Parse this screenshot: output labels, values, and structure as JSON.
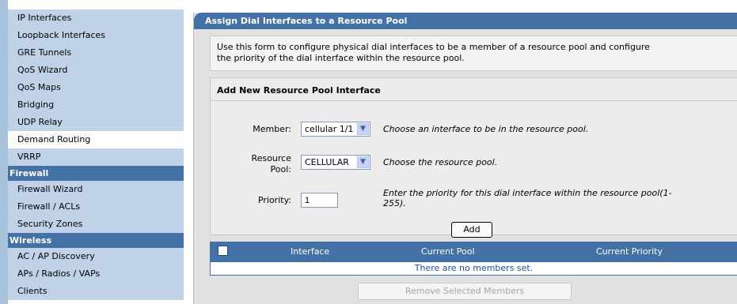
{
  "sidebar": {
    "items": [
      {
        "label": "IP Interfaces",
        "type": "item"
      },
      {
        "label": "Loopback Interfaces",
        "type": "item"
      },
      {
        "label": "GRE Tunnels",
        "type": "item"
      },
      {
        "label": "QoS Wizard",
        "type": "item"
      },
      {
        "label": "QoS Maps",
        "type": "item"
      },
      {
        "label": "Bridging",
        "type": "item"
      },
      {
        "label": "UDP Relay",
        "type": "item"
      },
      {
        "label": "Demand Routing",
        "type": "item",
        "active": true
      },
      {
        "label": "VRRP",
        "type": "item"
      },
      {
        "label": "Firewall",
        "type": "heading"
      },
      {
        "label": "Firewall Wizard",
        "type": "item"
      },
      {
        "label": "Firewall / ACLs",
        "type": "item"
      },
      {
        "label": "Security Zones",
        "type": "item"
      },
      {
        "label": "Wireless",
        "type": "heading"
      },
      {
        "label": "AC / AP Discovery",
        "type": "item"
      },
      {
        "label": "APs / Radios / VAPs",
        "type": "item"
      },
      {
        "label": "Clients",
        "type": "item"
      }
    ]
  },
  "panel": {
    "title": "Assign Dial Interfaces to a Resource Pool",
    "description_line1": "Use this form to configure physical dial interfaces to be a member of a resource pool and configure",
    "description_line2": "the priority of the dial interface within the resource pool."
  },
  "form": {
    "title": "Add New Resource Pool Interface",
    "member_label": "Member:",
    "member_value": "cellular 1/1",
    "member_hint": "Choose an interface to be in the resource pool.",
    "pool_label_line1": "Resource",
    "pool_label_line2": "Pool:",
    "pool_value": "CELLULAR",
    "pool_hint": "Choose the resource pool.",
    "priority_label": "Priority:",
    "priority_value": "1",
    "priority_hint_line1": "Enter the priority for this dial interface within the resource pool(1-",
    "priority_hint_line2": "255).",
    "add_label": "Add"
  },
  "members": {
    "columns": [
      "Interface",
      "Current Pool",
      "Current Priority"
    ],
    "empty_text": "There are no members set.",
    "remove_label": "Remove Selected Members"
  },
  "colors": {
    "header_blue": "#4471a6",
    "sidebar_blue": "#c0d2e7",
    "panel_gray": "#e1e1e1"
  }
}
